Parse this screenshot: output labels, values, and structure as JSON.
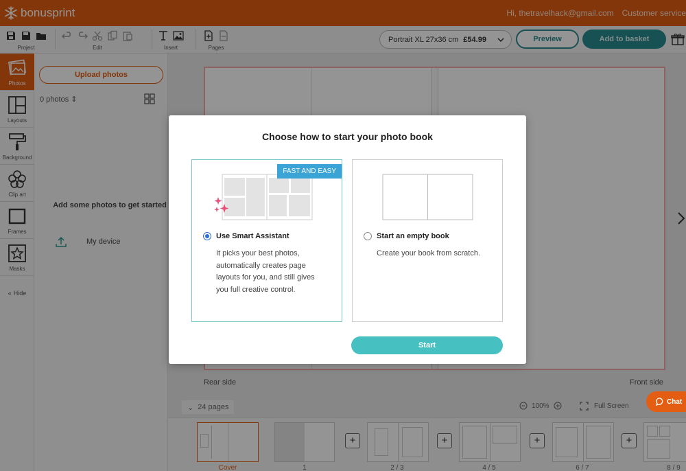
{
  "header": {
    "logo_text": "bonusprint",
    "greeting": "Hi, thetravelhack@gmail.com",
    "customer_service": "Customer service"
  },
  "toolbar": {
    "project_label": "Project",
    "edit_label": "Edit",
    "insert_label": "Insert",
    "pages_label": "Pages",
    "product_name": "Portrait XL 27x36 cm",
    "product_price": "£54.99",
    "preview_label": "Preview",
    "basket_label": "Add to basket"
  },
  "rail": {
    "photos": "Photos",
    "layouts": "Layouts",
    "background": "Background",
    "clipart": "Clip art",
    "frames": "Frames",
    "masks": "Masks",
    "hide": "Hide"
  },
  "panel": {
    "upload_label": "Upload photos",
    "photo_count": "0 photos",
    "empty_message": "Add some photos to get started",
    "device_label": "My device"
  },
  "canvas": {
    "rear_label": "Rear side",
    "front_label": "Front side"
  },
  "bottom": {
    "pages_count": "24 pages",
    "zoom_level": "100%",
    "fullscreen_label": "Full Screen",
    "chat_label": "Chat",
    "thumbs": [
      {
        "label": "Cover"
      },
      {
        "label": "1"
      },
      {
        "label": "2 / 3"
      },
      {
        "label": "4 / 5"
      },
      {
        "label": "6 / 7"
      },
      {
        "label": "8 / 9"
      }
    ]
  },
  "modal": {
    "title": "Choose how to start your photo book",
    "smart": {
      "badge": "FAST AND EASY",
      "title": "Use Smart Assistant",
      "description": "It picks your best photos, automatically creates page layouts for you, and still gives you full creative control.",
      "selected": true
    },
    "empty": {
      "title": "Start an empty book",
      "description": "Create your book from scratch.",
      "selected": false
    },
    "start_label": "Start"
  },
  "colors": {
    "brand_orange": "#e35e13",
    "teal": "#2a8c90",
    "start_teal": "#47c0c2",
    "badge_blue": "#3ba4d6"
  }
}
